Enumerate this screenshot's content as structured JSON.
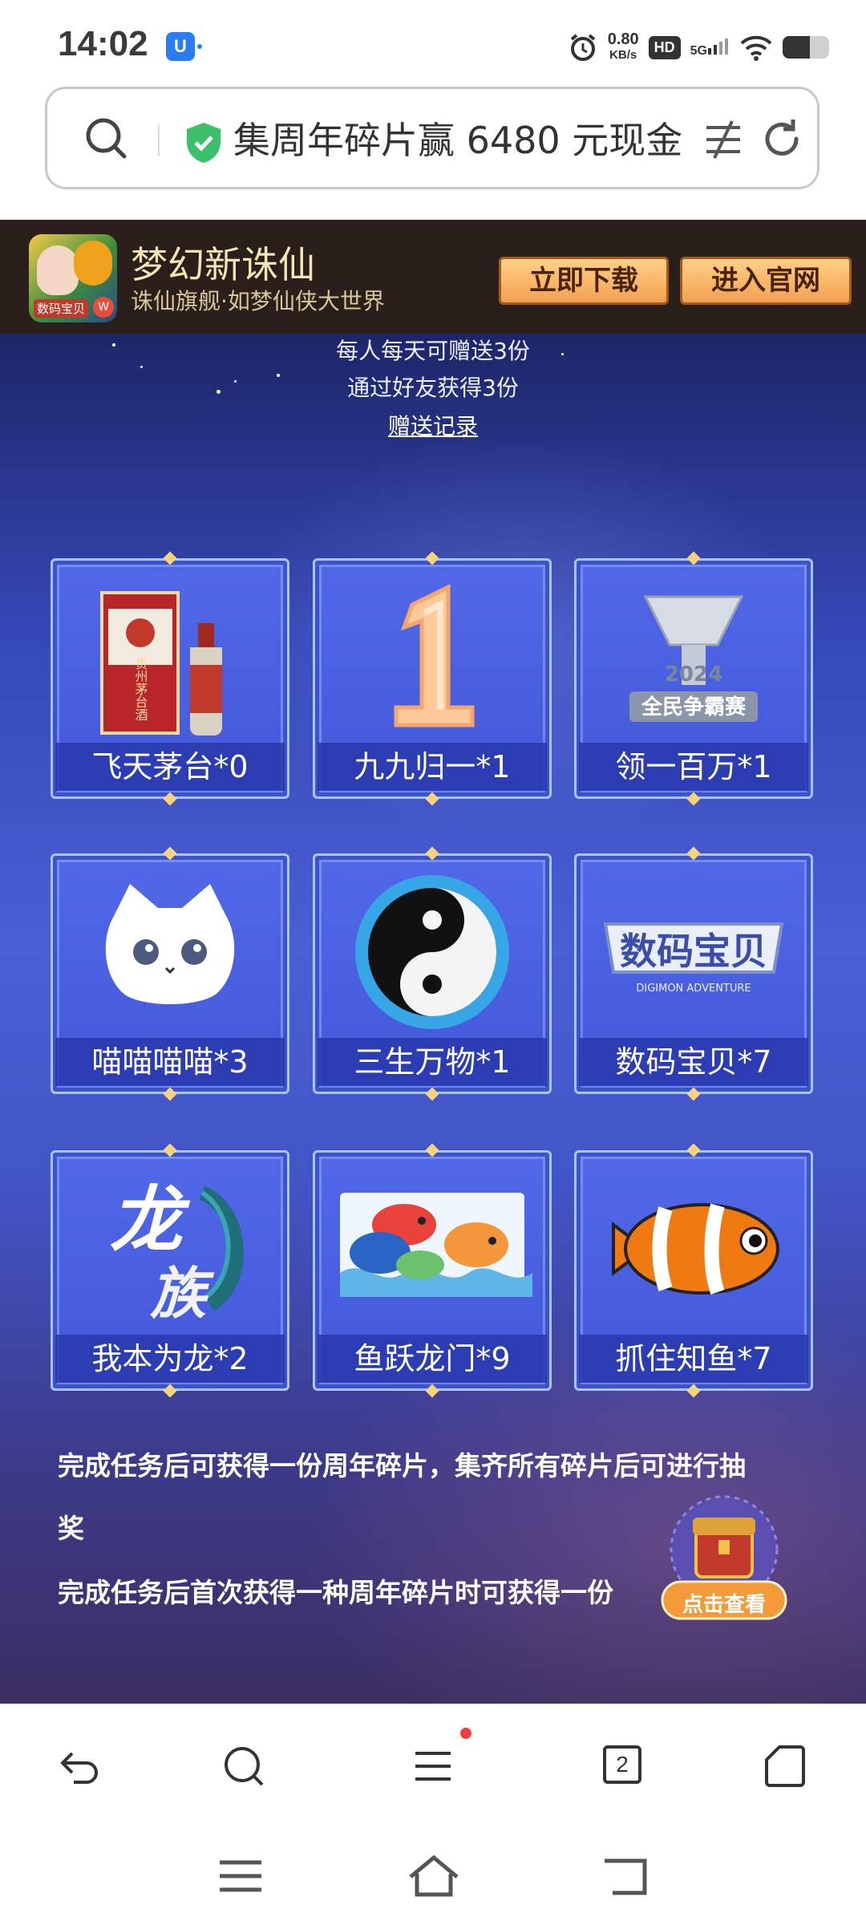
{
  "status_bar": {
    "time": "14:02",
    "app_badge": "U",
    "net_speed_value": "0.80",
    "net_speed_unit": "KB/s",
    "hd": "HD",
    "signal": "5G",
    "battery_level": 0.58
  },
  "address_bar": {
    "title": "集周年碎片赢 6480 元现金"
  },
  "app_banner": {
    "app_name": "梦幻新诛仙",
    "subtitle": "诛仙旗舰·如梦仙侠大世界",
    "logo_label": "数码宝贝",
    "download_button": "立即下载",
    "official_site_button": "进入官网"
  },
  "gift_info": {
    "line1": "每人每天可赠送3份",
    "line2": "通过好友获得3份",
    "record_link": "赠送记录"
  },
  "fragments": [
    {
      "label": "飞天茅台*0",
      "icon": "moutai-icon"
    },
    {
      "label": "九九归一*1",
      "icon": "number-one-icon"
    },
    {
      "label": "领一百万*1",
      "icon": "trophy-2024-icon"
    },
    {
      "label": "喵喵喵喵*3",
      "icon": "cat-icon"
    },
    {
      "label": "三生万物*1",
      "icon": "yin-yang-icon"
    },
    {
      "label": "数码宝贝*7",
      "icon": "digimon-logo-icon"
    },
    {
      "label": "我本为龙*2",
      "icon": "dragon-clan-icon"
    },
    {
      "label": "鱼跃龙门*9",
      "icon": "fish-group-icon"
    },
    {
      "label": "抓住知鱼*7",
      "icon": "clownfish-icon"
    }
  ],
  "art_text": {
    "moutai": "贵州茅台酒",
    "trophy_year": "2024",
    "trophy_text": "全民争霸赛",
    "digimon": "数码宝贝",
    "digimon_en": "DIGIMON ADVENTURE",
    "dragon_1": "龙",
    "dragon_2": "族"
  },
  "description": {
    "line1": "完成任务后可获得一份周年碎片，集齐所有碎片后可进行抽",
    "line1_cont": "奖",
    "line2": "完成任务后首次获得一种周年碎片时可获得一份"
  },
  "float_button": {
    "label": "点击查看"
  },
  "bottom_nav": {
    "tab_count": "2"
  },
  "colors": {
    "banner_bg": "#2a1f1b",
    "accent_gold": "#f3a04f",
    "page_blue": "#4a5fd4"
  }
}
